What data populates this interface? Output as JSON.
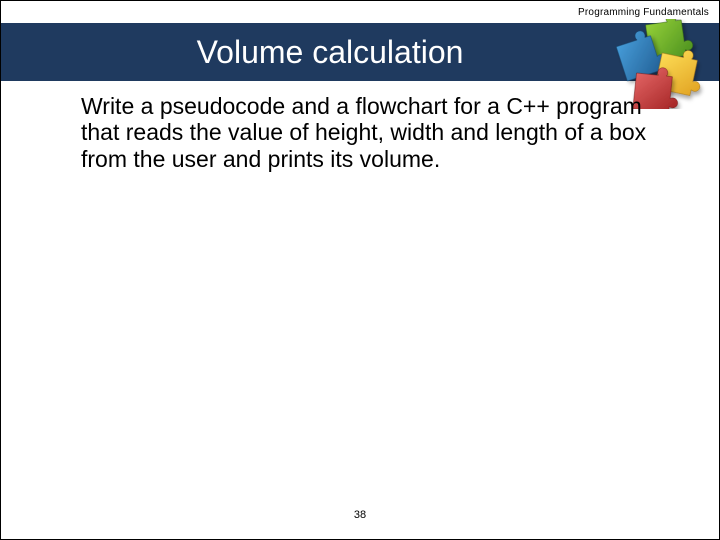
{
  "header": {
    "course_label": "Programming Fundamentals"
  },
  "title": "Volume calculation",
  "body": {
    "text": "Write a pseudocode and a flowchart for a C++ program that reads the value of height, width and length of a box from the user and prints its volume."
  },
  "footer": {
    "page_number": "38"
  }
}
